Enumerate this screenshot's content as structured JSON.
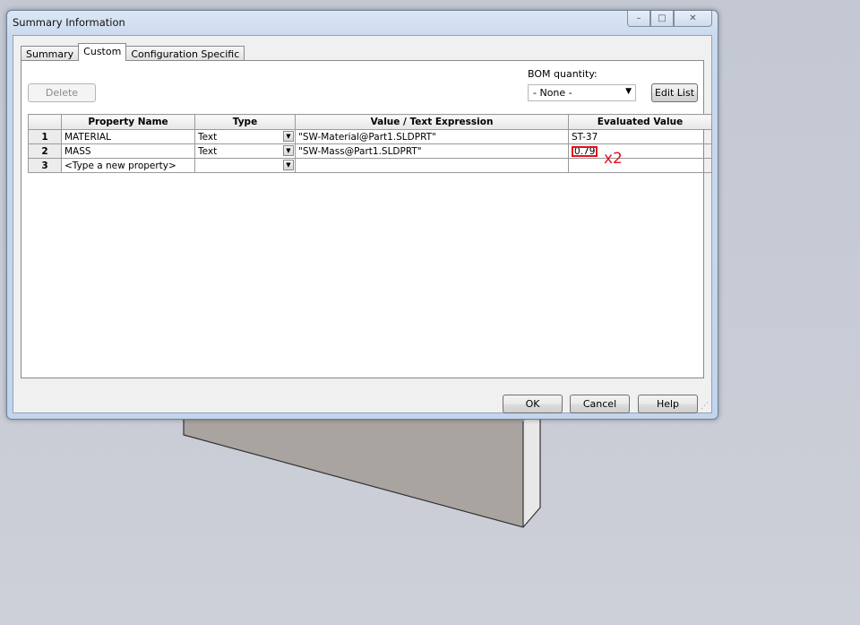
{
  "window": {
    "title": "Summary Information",
    "controls": {
      "minimize": "minimize-icon",
      "maximize": "maximize-icon",
      "close": "close-icon"
    }
  },
  "tabs": [
    {
      "label": "Summary",
      "active": false
    },
    {
      "label": "Custom",
      "active": true
    },
    {
      "label": "Configuration Specific",
      "active": false
    }
  ],
  "toolbar": {
    "delete_label": "Delete",
    "bom_label": "BOM quantity:",
    "bom_value": "- None -",
    "edit_list_label": "Edit List"
  },
  "table": {
    "columns": [
      "",
      "Property Name",
      "Type",
      "Value / Text Expression",
      "Evaluated Value"
    ],
    "rows": [
      {
        "num": "1",
        "name": "MATERIAL",
        "type": "Text",
        "expr": "\"SW-Material@Part1.SLDPRT\"",
        "evaluated": "ST-37"
      },
      {
        "num": "2",
        "name": "MASS",
        "type": "Text",
        "expr": "\"SW-Mass@Part1.SLDPRT\"",
        "evaluated": "0.79"
      },
      {
        "num": "3",
        "name": "<Type a new property>",
        "type": "",
        "expr": "",
        "evaluated": ""
      }
    ]
  },
  "annotation": "x2",
  "buttons": {
    "ok": "OK",
    "cancel": "Cancel",
    "help": "Help"
  },
  "colors": {
    "highlight": "#e3101e",
    "part_face": "#a9a49f"
  }
}
